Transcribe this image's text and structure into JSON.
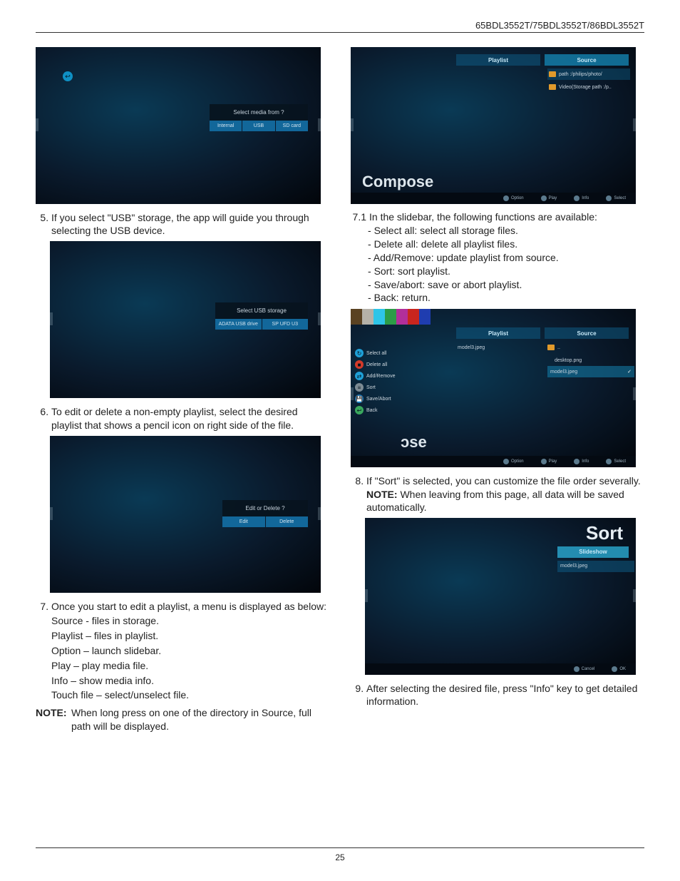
{
  "header": {
    "models": "65BDL3552T/75BDL3552T/86BDL3552T"
  },
  "pagenum": "25",
  "left": {
    "step5": "If you select \"USB\" storage, the app will guide you through selecting the USB device.",
    "ss1": {
      "dialog_title": "Select media from ?",
      "btn1": "Internal",
      "btn2": "USB",
      "btn3": "SD card"
    },
    "ss2": {
      "dialog_title": "Select USB storage",
      "btn1": "ADATA USB drive",
      "btn2": "SP UFD U3"
    },
    "step6": "To edit or delete a non-empty playlist, select the desired playlist that shows a pencil icon on right side of the file.",
    "ss3": {
      "dialog_title": "Edit or Delete ?",
      "btn1": "Edit",
      "btn2": "Delete"
    },
    "step7": "Once you start to edit a playlist, a menu is displayed as below:",
    "step7_lines": [
      "Source - files in storage.",
      "Playlist – files in playlist.",
      "Option – launch slidebar.",
      "Play – play media file.",
      "Info – show media info.",
      "Touch file – select/unselect file."
    ],
    "note": "When long press on one of the directory in Source, full path will be displayed."
  },
  "right": {
    "ss4": {
      "compose": "Compose",
      "tab_playlist": "Playlist",
      "tab_source": "Source",
      "row1": "path :/philips/photo/",
      "row2": "Video(Storage path :/p..",
      "foot": {
        "a": "Option",
        "b": "Play",
        "c": "Info",
        "d": "Select"
      }
    },
    "step71": "In the slidebar, the following functions are available:",
    "step71_lines": [
      "Select all: select all storage files.",
      "Delete all: delete all playlist files.",
      "Add/Remove: update playlist from source.",
      "Sort: sort playlist.",
      "Save/abort: save or abort playlist.",
      "Back: return."
    ],
    "ss5": {
      "compose_tail": "ɔse",
      "tab_playlist": "Playlist",
      "tab_source": "Source",
      "pl_item": "model3.jpeg",
      "src_up": "..",
      "src1": "desktop.png",
      "src2": "model3.jpeg",
      "side": {
        "a": "Select all",
        "b": "Delete all",
        "c": "Add/Remove",
        "d": "Sort",
        "e": "Save/Abort",
        "f": "Back"
      },
      "foot": {
        "a": "Option",
        "b": "Play",
        "c": "Info",
        "d": "Select"
      }
    },
    "step8": "If \"Sort\" is selected, you can customize the file order severally.",
    "step8_note": "When leaving from this page, all data will be saved automatically.",
    "ss6": {
      "sort": "Sort",
      "tab": "Slideshow",
      "item": "model3.jpeg",
      "foot": {
        "a": "Cancel",
        "b": "OK"
      }
    },
    "step9": "After selecting the desired file, press \"Info\" key to get detailed information."
  },
  "note_label": "NOTE:"
}
